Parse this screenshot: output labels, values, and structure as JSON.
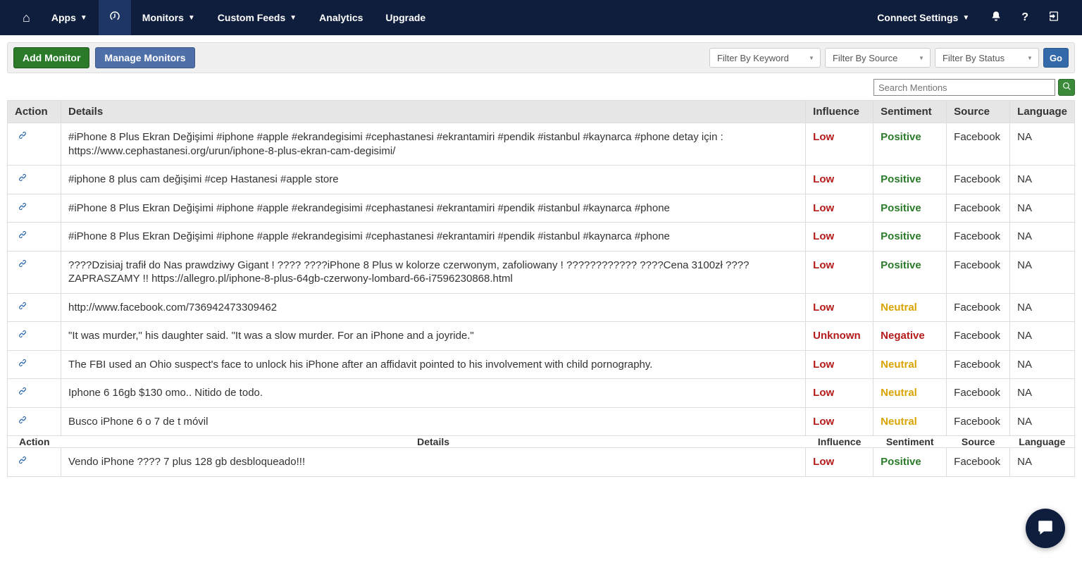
{
  "nav": {
    "home_aria": "Home",
    "apps": "Apps",
    "dashboard_aria": "Dashboard",
    "monitors": "Monitors",
    "custom_feeds": "Custom Feeds",
    "analytics": "Analytics",
    "upgrade": "Upgrade",
    "connect_settings": "Connect Settings",
    "notifications_aria": "Notifications",
    "help_aria": "Help",
    "logout_aria": "Logout"
  },
  "toolbar": {
    "add_monitor": "Add Monitor",
    "manage_monitors": "Manage Monitors",
    "filter_keyword": "Filter By Keyword",
    "filter_source": "Filter By Source",
    "filter_status": "Filter By Status",
    "go_label": "Go"
  },
  "search": {
    "placeholder": "Search Mentions",
    "aria": "Search"
  },
  "columns": {
    "action": "Action",
    "details": "Details",
    "influence": "Influence",
    "sentiment": "Sentiment",
    "source": "Source",
    "language": "Language"
  },
  "rows": [
    {
      "details": "#iPhone 8 Plus Ekran Değişimi #iphone #apple #ekrandegisimi #cephastanesi #ekrantamiri #pendik #istanbul #kaynarca #phone detay için : https://www.cephastanesi.org/urun/iphone-8-plus-ekran-cam-degisimi/",
      "influence": "Low",
      "sentiment": "Positive",
      "source": "Facebook",
      "language": "NA"
    },
    {
      "details": "#iphone 8 plus cam değişimi #cep Hastanesi #apple store",
      "influence": "Low",
      "sentiment": "Positive",
      "source": "Facebook",
      "language": "NA"
    },
    {
      "details": "#iPhone 8 Plus Ekran Değişimi #iphone #apple #ekrandegisimi #cephastanesi #ekrantamiri #pendik #istanbul #kaynarca #phone",
      "influence": "Low",
      "sentiment": "Positive",
      "source": "Facebook",
      "language": "NA"
    },
    {
      "details": "#iPhone 8 Plus Ekran Değişimi #iphone #apple #ekrandegisimi #cephastanesi #ekrantamiri #pendik #istanbul #kaynarca #phone",
      "influence": "Low",
      "sentiment": "Positive",
      "source": "Facebook",
      "language": "NA"
    },
    {
      "details": "????Dzisiaj trafił do Nas prawdziwy Gigant ! ???? ????iPhone 8 Plus w kolorze czerwonym, zafoliowany ! ???????????? ????Cena 3100zł ????ZAPRASZAMY !! https://allegro.pl/iphone-8-plus-64gb-czerwony-lombard-66-i7596230868.html",
      "influence": "Low",
      "sentiment": "Positive",
      "source": "Facebook",
      "language": "NA"
    },
    {
      "details": "http://www.facebook.com/736942473309462",
      "influence": "Low",
      "sentiment": "Neutral",
      "source": "Facebook",
      "language": "NA"
    },
    {
      "details": "\"It was murder,\" his daughter said. \"It was a slow murder. For an iPhone and a joyride.\"",
      "influence": "Unknown",
      "sentiment": "Negative",
      "source": "Facebook",
      "language": "NA"
    },
    {
      "details": "The FBI used an Ohio suspect's face to unlock his iPhone after an affidavit pointed to his involvement with child pornography.",
      "influence": "Low",
      "sentiment": "Neutral",
      "source": "Facebook",
      "language": "NA"
    },
    {
      "details": "Iphone 6 16gb $130 omo.. Nitido de todo.",
      "influence": "Low",
      "sentiment": "Neutral",
      "source": "Facebook",
      "language": "NA"
    },
    {
      "details": "Busco iPhone 6 o 7 de t móvil",
      "influence": "Low",
      "sentiment": "Neutral",
      "source": "Facebook",
      "language": "NA"
    },
    {
      "details": "Vendo iPhone ???? 7 plus 128 gb desbloqueado!!!",
      "influence": "Low",
      "sentiment": "Positive",
      "source": "Facebook",
      "language": "NA"
    }
  ],
  "chat_aria": "Chat"
}
